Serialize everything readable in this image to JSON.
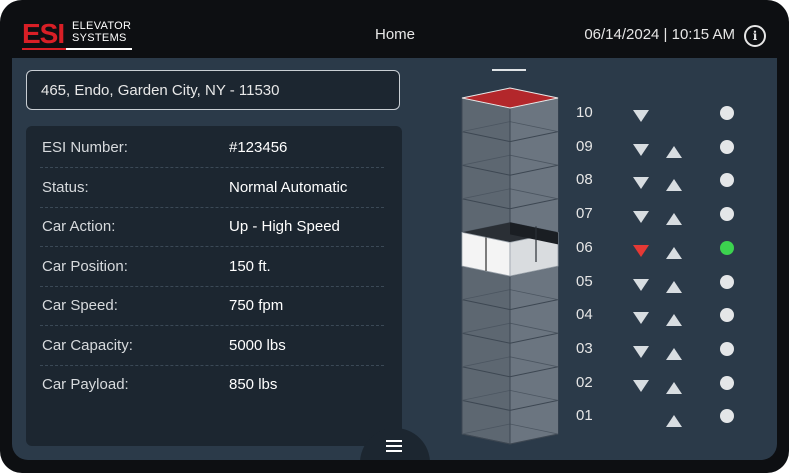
{
  "header": {
    "logo_text": "ESI",
    "logo_sub_line1": "ELEVATOR",
    "logo_sub_line2": "SYSTEMS",
    "title": "Home",
    "datetime": "06/14/2024 | 10:15 AM",
    "info_icon": "info-icon"
  },
  "address": "465, Endo, Garden City, NY - 11530",
  "details": [
    {
      "label": "ESI Number:",
      "value": "#123456"
    },
    {
      "label": "Status:",
      "value": "Normal Automatic"
    },
    {
      "label": "Car Action:",
      "value": "Up - High Speed"
    },
    {
      "label": "Car Position:",
      "value": "150 ft."
    },
    {
      "label": "Car Speed:",
      "value": "750 fpm"
    },
    {
      "label": "Car Capacity:",
      "value": "5000 lbs"
    },
    {
      "label": "Car Payload:",
      "value": "850 lbs"
    }
  ],
  "floors": [
    {
      "num": "10",
      "down": true,
      "up": false,
      "down_active": false,
      "dot_active": false
    },
    {
      "num": "09",
      "down": true,
      "up": true,
      "down_active": false,
      "dot_active": false
    },
    {
      "num": "08",
      "down": true,
      "up": true,
      "down_active": false,
      "dot_active": false
    },
    {
      "num": "07",
      "down": true,
      "up": true,
      "down_active": false,
      "dot_active": false
    },
    {
      "num": "06",
      "down": true,
      "up": true,
      "down_active": true,
      "dot_active": true
    },
    {
      "num": "05",
      "down": true,
      "up": true,
      "down_active": false,
      "dot_active": false
    },
    {
      "num": "04",
      "down": true,
      "up": true,
      "down_active": false,
      "dot_active": false
    },
    {
      "num": "03",
      "down": true,
      "up": true,
      "down_active": false,
      "dot_active": false
    },
    {
      "num": "02",
      "down": true,
      "up": true,
      "down_active": false,
      "dot_active": false
    },
    {
      "num": "01",
      "down": false,
      "up": true,
      "down_active": false,
      "dot_active": false
    }
  ],
  "car_floor": "06",
  "colors": {
    "brand_red": "#d81f26",
    "active_call": "#e53935",
    "car_here": "#3cd34f",
    "roof": "#b3272b"
  },
  "menu_icon": "hamburger-menu-icon"
}
